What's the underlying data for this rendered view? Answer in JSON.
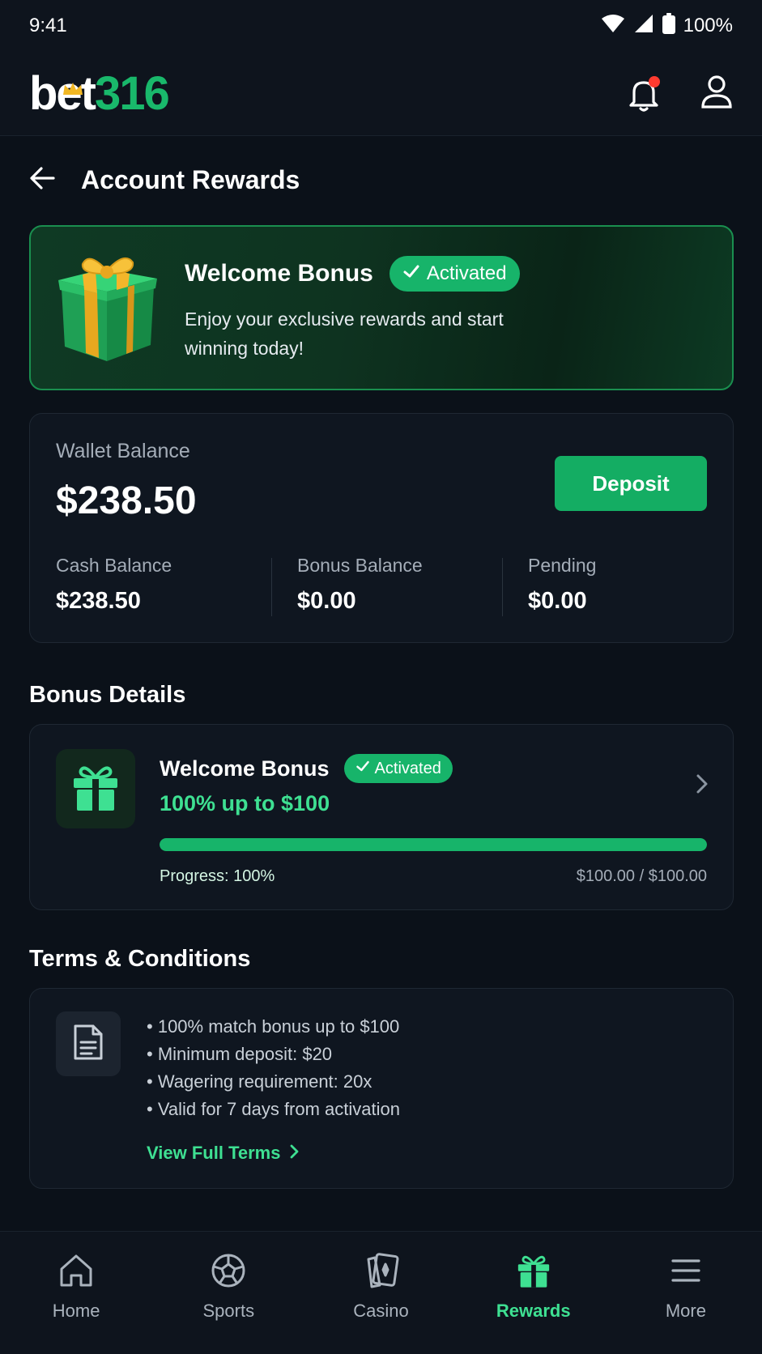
{
  "status_bar": {
    "time": "9:41",
    "battery": "100%"
  },
  "header": {
    "logo_prefix": "bet",
    "logo_suffix": "316",
    "notification_badge": true
  },
  "page": {
    "title": "Account Rewards"
  },
  "welcome_banner": {
    "title": "Welcome Bonus",
    "badge": "Activated",
    "description": "Enjoy your exclusive rewards and start winning today!"
  },
  "wallet": {
    "label": "Wallet Balance",
    "amount": "$238.50",
    "deposit_label": "Deposit",
    "balances": [
      {
        "label": "Cash Balance",
        "value": "$238.50"
      },
      {
        "label": "Bonus Balance",
        "value": "$0.00"
      },
      {
        "label": "Pending",
        "value": "$0.00"
      }
    ]
  },
  "bonus_details": {
    "section_title": "Bonus Details",
    "title": "Welcome Bonus",
    "badge": "Activated",
    "subtitle": "100% up to $100",
    "progress_fraction": 1.0,
    "progress_label": "Progress: 100%",
    "progress_amount": "$100.00 / $100.00"
  },
  "terms": {
    "section_title": "Terms & Conditions",
    "items": [
      "100% match bonus up to $100",
      "Minimum deposit: $20",
      "Wagering requirement: 20x",
      "Valid for 7 days from activation"
    ],
    "link_label": "View Full Terms"
  },
  "colors": {
    "accent": "#17b46a",
    "accent_text": "#3ee092",
    "background": "#0b1119",
    "card": "#0f1620",
    "notification": "#ff3b30"
  },
  "nav": {
    "items": [
      {
        "label": "Home",
        "icon": "home-icon"
      },
      {
        "label": "Sports",
        "icon": "soccer-ball-icon"
      },
      {
        "label": "Casino",
        "icon": "cards-icon"
      },
      {
        "label": "Rewards",
        "icon": "gift-icon"
      },
      {
        "label": "More",
        "icon": "menu-icon"
      }
    ],
    "active": "Rewards"
  }
}
